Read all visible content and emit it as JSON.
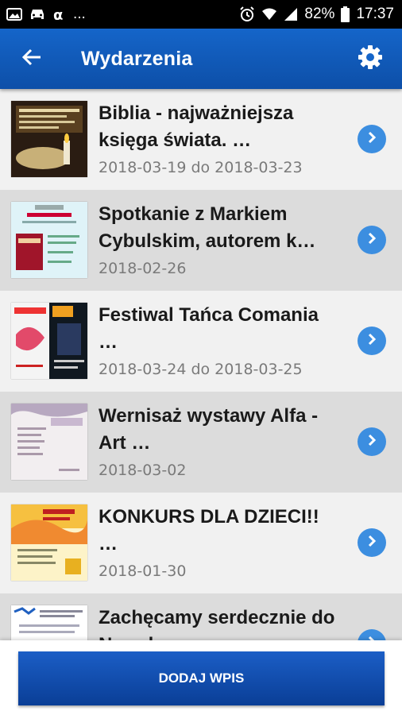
{
  "status_bar": {
    "left_icons": [
      "image-icon",
      "car-icon",
      "notification-icon"
    ],
    "overflow": "...",
    "battery": "82%",
    "time": "17:37"
  },
  "app_bar": {
    "title": "Wydarzenia",
    "back_icon": "arrow-left-icon",
    "settings_icon": "gear-icon"
  },
  "events": [
    {
      "title": "Biblia - najważniejsza księga świata. …",
      "date": "2018-03-19 do 2018-03-23"
    },
    {
      "title": "Spotkanie z Markiem Cybulskim, autorem k…",
      "date": "2018-02-26"
    },
    {
      "title": "Festiwal Tańca Comania …",
      "date": "2018-03-24 do 2018-03-25"
    },
    {
      "title": "Wernisaż wystawy Alfa - Art  …",
      "date": "2018-03-02"
    },
    {
      "title": "KONKURS DLA DZIECI!! …",
      "date": "2018-01-30"
    },
    {
      "title": "Zachęcamy serdecznie do Narodowego …",
      "date": ""
    }
  ],
  "bottom": {
    "add_button_label": "DODAJ WPIS"
  },
  "colors": {
    "app_bar": "#1565c9",
    "chevron": "#3c8ee0",
    "add_button": "#1b5ec6"
  }
}
